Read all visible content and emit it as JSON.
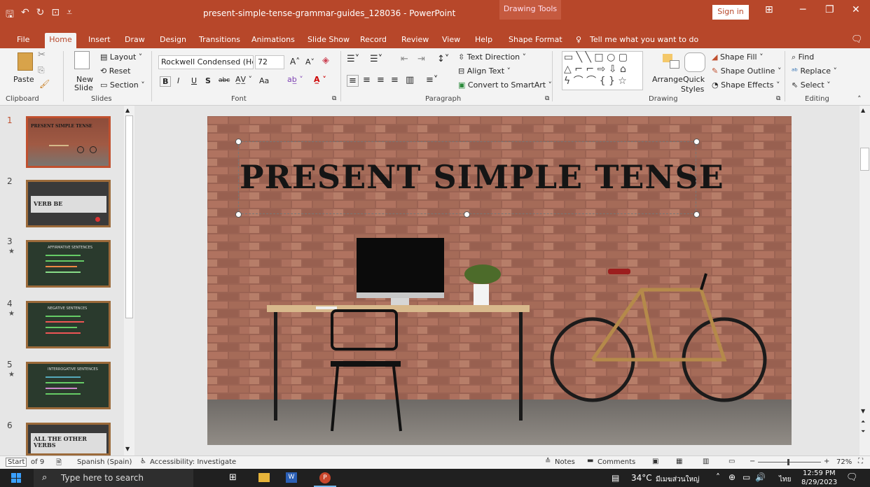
{
  "titlebar": {
    "doc_title": "present-simple-tense-grammar-guides_128036 - PowerPoint",
    "context_tools": "Drawing Tools",
    "signin": "Sign in"
  },
  "tabs": [
    "File",
    "Home",
    "Insert",
    "Draw",
    "Design",
    "Transitions",
    "Animations",
    "Slide Show",
    "Record",
    "Review",
    "View",
    "Help",
    "Shape Format"
  ],
  "tell_me": "Tell me what you want to do",
  "ribbon": {
    "clipboard": {
      "paste": "Paste",
      "label": "Clipboard"
    },
    "slides": {
      "new_slide": "New",
      "new_slide2": "Slide",
      "layout": "Layout",
      "reset": "Reset",
      "section": "Section",
      "label": "Slides"
    },
    "font": {
      "name": "Rockwell Condensed (He…",
      "size": "72",
      "label": "Font",
      "bold": "B",
      "italic": "I",
      "underline": "U",
      "shadow": "S",
      "strike": "abc",
      "aa": "Aa"
    },
    "paragraph": {
      "text_direction": "Text Direction",
      "align_text": "Align Text",
      "convert": "Convert to SmartArt",
      "label": "Paragraph"
    },
    "drawing": {
      "arrange": "Arrange",
      "quick": "Quick",
      "styles": "Styles",
      "shape_fill": "Shape Fill",
      "shape_outline": "Shape Outline",
      "shape_effects": "Shape Effects",
      "label": "Drawing"
    },
    "editing": {
      "find": "Find",
      "replace": "Replace",
      "select": "Select",
      "label": "Editing"
    }
  },
  "thumbnails": [
    {
      "num": "1",
      "title": "PRESENT SIMPLE TENSE"
    },
    {
      "num": "2",
      "title": "VERB BE"
    },
    {
      "num": "3",
      "title": "AFFIRMATIVE SENTENCES"
    },
    {
      "num": "4",
      "title": "NEGATIVE SENTENCES"
    },
    {
      "num": "5",
      "title": "INTERROGATIVE SENTENCES"
    },
    {
      "num": "6",
      "title": "ALL THE OTHER VERBS"
    }
  ],
  "slide": {
    "title": "PRESENT SIMPLE TENSE"
  },
  "status": {
    "slide_pos_a": "Start",
    "slide_pos_b": "of 9",
    "language": "Spanish (Spain)",
    "accessibility": "Accessibility: Investigate",
    "notes": "Notes",
    "comments": "Comments",
    "zoom": "72%"
  },
  "taskbar": {
    "search": "Type here to search",
    "weather": "34°C",
    "weather_desc": "มีเมฆส่วนใหญ่",
    "lang": "ไทย",
    "time": "12:59 PM",
    "date": "8/29/2023"
  }
}
